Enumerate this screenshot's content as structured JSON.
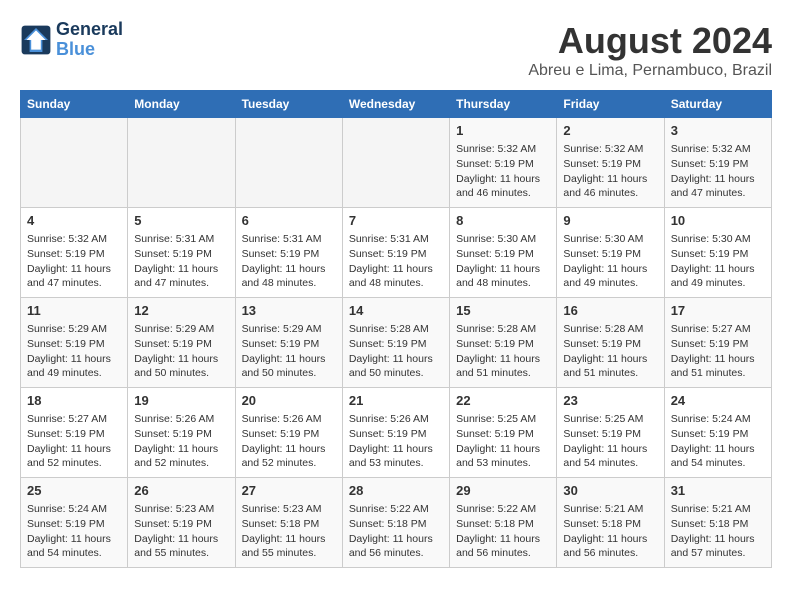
{
  "header": {
    "logo_line1": "General",
    "logo_line2": "Blue",
    "month_title": "August 2024",
    "location": "Abreu e Lima, Pernambuco, Brazil"
  },
  "days_of_week": [
    "Sunday",
    "Monday",
    "Tuesday",
    "Wednesday",
    "Thursday",
    "Friday",
    "Saturday"
  ],
  "weeks": [
    [
      {
        "day": "",
        "info": ""
      },
      {
        "day": "",
        "info": ""
      },
      {
        "day": "",
        "info": ""
      },
      {
        "day": "",
        "info": ""
      },
      {
        "day": "1",
        "info": "Sunrise: 5:32 AM\nSunset: 5:19 PM\nDaylight: 11 hours\nand 46 minutes."
      },
      {
        "day": "2",
        "info": "Sunrise: 5:32 AM\nSunset: 5:19 PM\nDaylight: 11 hours\nand 46 minutes."
      },
      {
        "day": "3",
        "info": "Sunrise: 5:32 AM\nSunset: 5:19 PM\nDaylight: 11 hours\nand 47 minutes."
      }
    ],
    [
      {
        "day": "4",
        "info": "Sunrise: 5:32 AM\nSunset: 5:19 PM\nDaylight: 11 hours\nand 47 minutes."
      },
      {
        "day": "5",
        "info": "Sunrise: 5:31 AM\nSunset: 5:19 PM\nDaylight: 11 hours\nand 47 minutes."
      },
      {
        "day": "6",
        "info": "Sunrise: 5:31 AM\nSunset: 5:19 PM\nDaylight: 11 hours\nand 48 minutes."
      },
      {
        "day": "7",
        "info": "Sunrise: 5:31 AM\nSunset: 5:19 PM\nDaylight: 11 hours\nand 48 minutes."
      },
      {
        "day": "8",
        "info": "Sunrise: 5:30 AM\nSunset: 5:19 PM\nDaylight: 11 hours\nand 48 minutes."
      },
      {
        "day": "9",
        "info": "Sunrise: 5:30 AM\nSunset: 5:19 PM\nDaylight: 11 hours\nand 49 minutes."
      },
      {
        "day": "10",
        "info": "Sunrise: 5:30 AM\nSunset: 5:19 PM\nDaylight: 11 hours\nand 49 minutes."
      }
    ],
    [
      {
        "day": "11",
        "info": "Sunrise: 5:29 AM\nSunset: 5:19 PM\nDaylight: 11 hours\nand 49 minutes."
      },
      {
        "day": "12",
        "info": "Sunrise: 5:29 AM\nSunset: 5:19 PM\nDaylight: 11 hours\nand 50 minutes."
      },
      {
        "day": "13",
        "info": "Sunrise: 5:29 AM\nSunset: 5:19 PM\nDaylight: 11 hours\nand 50 minutes."
      },
      {
        "day": "14",
        "info": "Sunrise: 5:28 AM\nSunset: 5:19 PM\nDaylight: 11 hours\nand 50 minutes."
      },
      {
        "day": "15",
        "info": "Sunrise: 5:28 AM\nSunset: 5:19 PM\nDaylight: 11 hours\nand 51 minutes."
      },
      {
        "day": "16",
        "info": "Sunrise: 5:28 AM\nSunset: 5:19 PM\nDaylight: 11 hours\nand 51 minutes."
      },
      {
        "day": "17",
        "info": "Sunrise: 5:27 AM\nSunset: 5:19 PM\nDaylight: 11 hours\nand 51 minutes."
      }
    ],
    [
      {
        "day": "18",
        "info": "Sunrise: 5:27 AM\nSunset: 5:19 PM\nDaylight: 11 hours\nand 52 minutes."
      },
      {
        "day": "19",
        "info": "Sunrise: 5:26 AM\nSunset: 5:19 PM\nDaylight: 11 hours\nand 52 minutes."
      },
      {
        "day": "20",
        "info": "Sunrise: 5:26 AM\nSunset: 5:19 PM\nDaylight: 11 hours\nand 52 minutes."
      },
      {
        "day": "21",
        "info": "Sunrise: 5:26 AM\nSunset: 5:19 PM\nDaylight: 11 hours\nand 53 minutes."
      },
      {
        "day": "22",
        "info": "Sunrise: 5:25 AM\nSunset: 5:19 PM\nDaylight: 11 hours\nand 53 minutes."
      },
      {
        "day": "23",
        "info": "Sunrise: 5:25 AM\nSunset: 5:19 PM\nDaylight: 11 hours\nand 54 minutes."
      },
      {
        "day": "24",
        "info": "Sunrise: 5:24 AM\nSunset: 5:19 PM\nDaylight: 11 hours\nand 54 minutes."
      }
    ],
    [
      {
        "day": "25",
        "info": "Sunrise: 5:24 AM\nSunset: 5:19 PM\nDaylight: 11 hours\nand 54 minutes."
      },
      {
        "day": "26",
        "info": "Sunrise: 5:23 AM\nSunset: 5:19 PM\nDaylight: 11 hours\nand 55 minutes."
      },
      {
        "day": "27",
        "info": "Sunrise: 5:23 AM\nSunset: 5:18 PM\nDaylight: 11 hours\nand 55 minutes."
      },
      {
        "day": "28",
        "info": "Sunrise: 5:22 AM\nSunset: 5:18 PM\nDaylight: 11 hours\nand 56 minutes."
      },
      {
        "day": "29",
        "info": "Sunrise: 5:22 AM\nSunset: 5:18 PM\nDaylight: 11 hours\nand 56 minutes."
      },
      {
        "day": "30",
        "info": "Sunrise: 5:21 AM\nSunset: 5:18 PM\nDaylight: 11 hours\nand 56 minutes."
      },
      {
        "day": "31",
        "info": "Sunrise: 5:21 AM\nSunset: 5:18 PM\nDaylight: 11 hours\nand 57 minutes."
      }
    ]
  ]
}
